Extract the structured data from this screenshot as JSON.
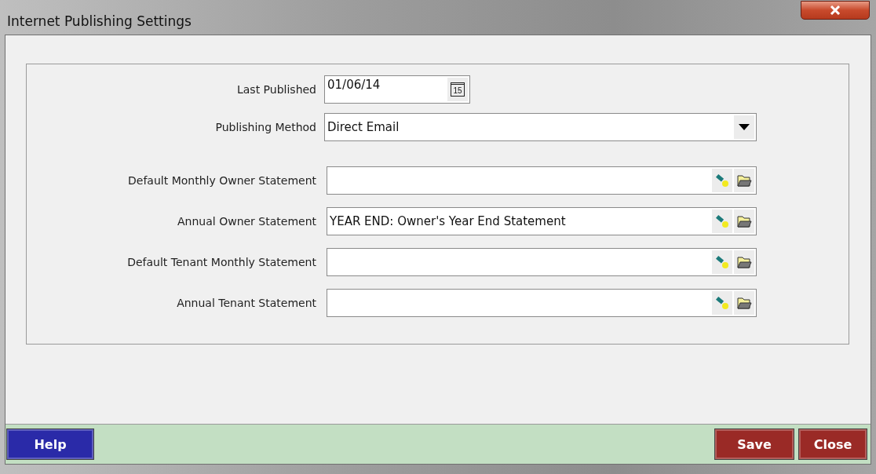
{
  "window": {
    "title": "Internet Publishing Settings"
  },
  "fields": [
    {
      "kind": "date",
      "label": "Last Published",
      "value": "01/06/14",
      "calendar_day": "15"
    },
    {
      "kind": "select",
      "label": "Publishing Method",
      "value": "Direct Email"
    },
    {
      "kind": "lookup",
      "label": "Default Monthly Owner Statement"
    },
    {
      "kind": "lookup",
      "label": "Annual Owner Statement",
      "value": "YEAR END: Owner's Year End Statement"
    },
    {
      "kind": "lookup",
      "label": "Default Tenant Monthly Statement"
    },
    {
      "kind": "lookup",
      "label": "Annual Tenant Statement"
    }
  ],
  "buttons": [
    {
      "kind": "help",
      "label": "Help"
    },
    {
      "kind": "save",
      "label": "Save"
    },
    {
      "kind": "close",
      "label": "Close"
    }
  ]
}
